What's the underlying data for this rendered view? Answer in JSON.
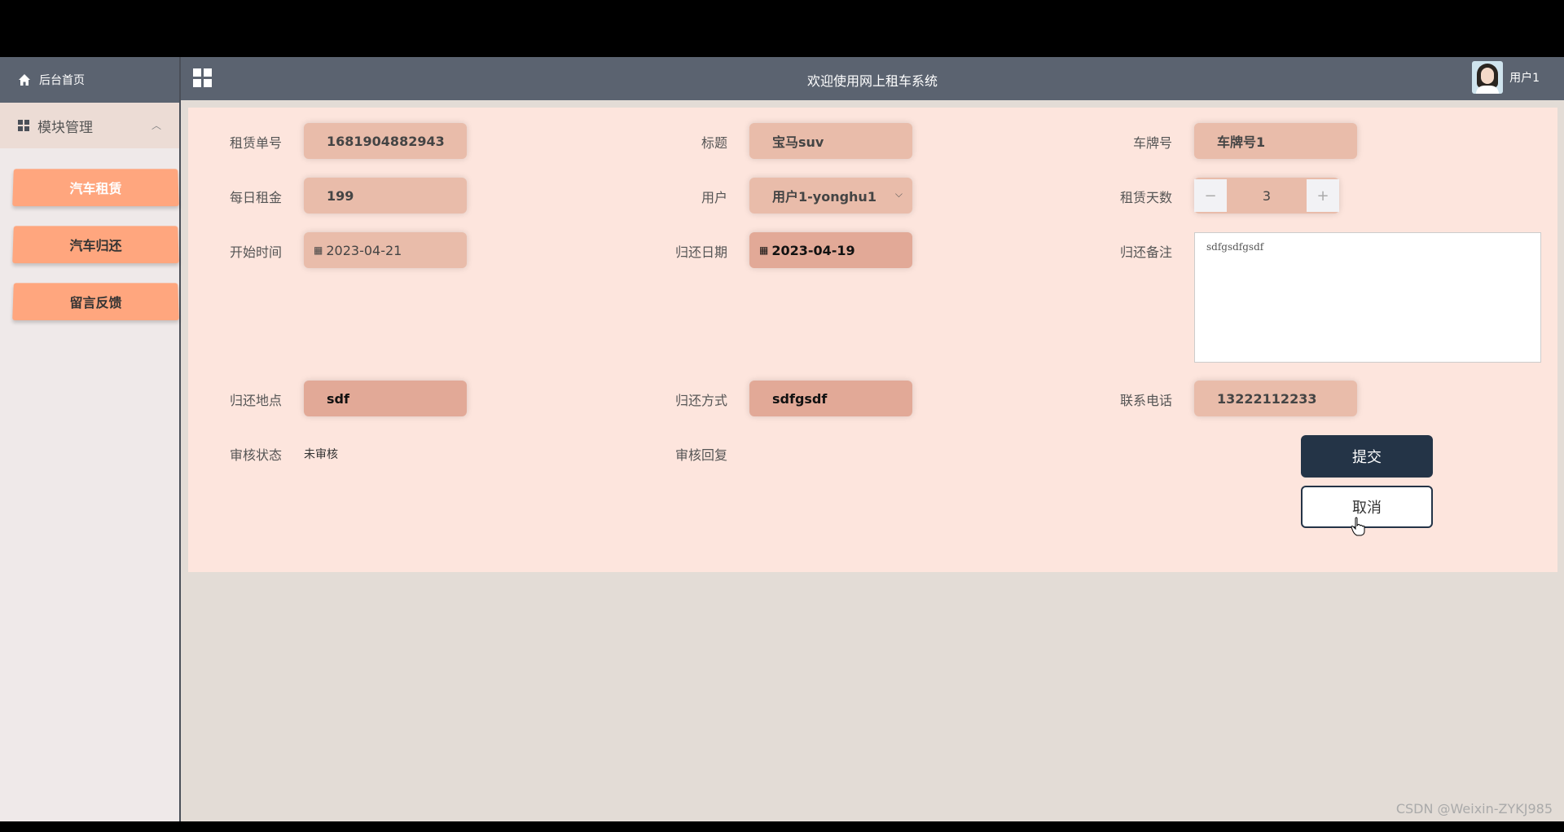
{
  "header": {
    "home_label": "后台首页",
    "title": "欢迎使用网上租车系统",
    "username": "用户1"
  },
  "sidebar": {
    "group_label": "模块管理",
    "items": [
      {
        "label": "汽车租赁"
      },
      {
        "label": "汽车归还"
      },
      {
        "label": "留言反馈"
      }
    ]
  },
  "form": {
    "order_no": {
      "label": "租赁单号",
      "value": "1681904882943"
    },
    "title": {
      "label": "标题",
      "value": "宝马suv"
    },
    "plate": {
      "label": "车牌号",
      "value": "车牌号1"
    },
    "daily_rent": {
      "label": "每日租金",
      "value": "199"
    },
    "user": {
      "label": "用户",
      "value": "用户1-yonghu1"
    },
    "days": {
      "label": "租赁天数",
      "value": "3"
    },
    "start_date": {
      "label": "开始时间",
      "value": "2023-04-21"
    },
    "return_date": {
      "label": "归还日期",
      "value": "2023-04-19"
    },
    "return_note": {
      "label": "归还备注",
      "value": "sdfgsdfgsdf"
    },
    "return_place": {
      "label": "归还地点",
      "value": "sdf"
    },
    "return_method": {
      "label": "归还方式",
      "value": "sdfgsdf"
    },
    "phone": {
      "label": "联系电话",
      "value": "13222112233"
    },
    "review_status": {
      "label": "审核状态",
      "value": "未审核"
    },
    "review_reply": {
      "label": "审核回复",
      "value": ""
    },
    "submit_label": "提交",
    "cancel_label": "取消"
  },
  "watermark": "CSDN @Weixin-ZYKJ985"
}
